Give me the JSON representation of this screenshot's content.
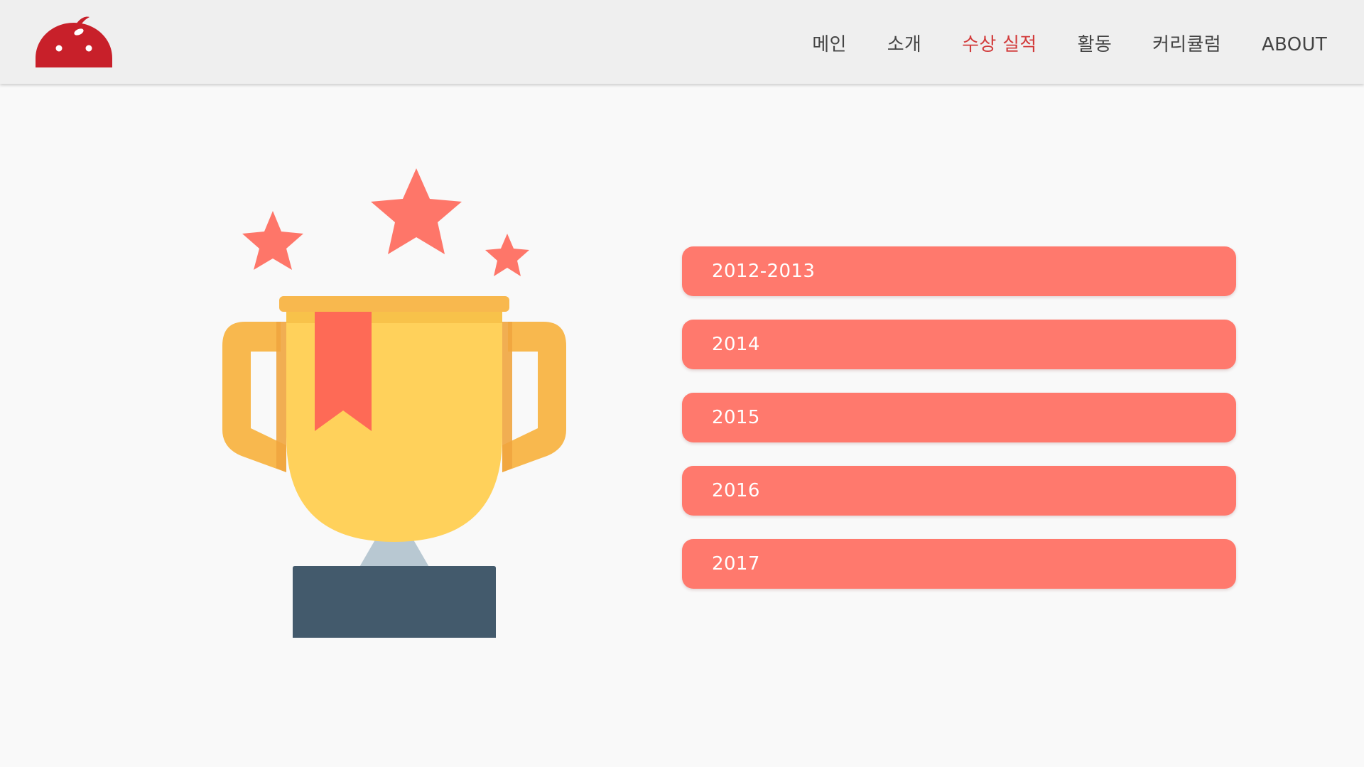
{
  "header": {
    "logo_icon": "red-dome-logo-icon",
    "nav": [
      {
        "label": "메인",
        "active": false
      },
      {
        "label": "소개",
        "active": false
      },
      {
        "label": "수상 실적",
        "active": true
      },
      {
        "label": "활동",
        "active": false
      },
      {
        "label": "커리큘럼",
        "active": false
      },
      {
        "label": "ABOUT",
        "active": false
      }
    ]
  },
  "main": {
    "illustration_icon": "trophy-with-stars-icon",
    "years": [
      {
        "label": "2012-2013"
      },
      {
        "label": "2014"
      },
      {
        "label": "2015"
      },
      {
        "label": "2016"
      },
      {
        "label": "2017"
      }
    ]
  },
  "colors": {
    "accent": "#d23b3b",
    "button": "#ff796d",
    "logo": "#c8202a",
    "trophy_cup": "#ffd15b",
    "trophy_handle": "#f8b84e",
    "trophy_base": "#435a6c",
    "star": "#fe7669"
  }
}
